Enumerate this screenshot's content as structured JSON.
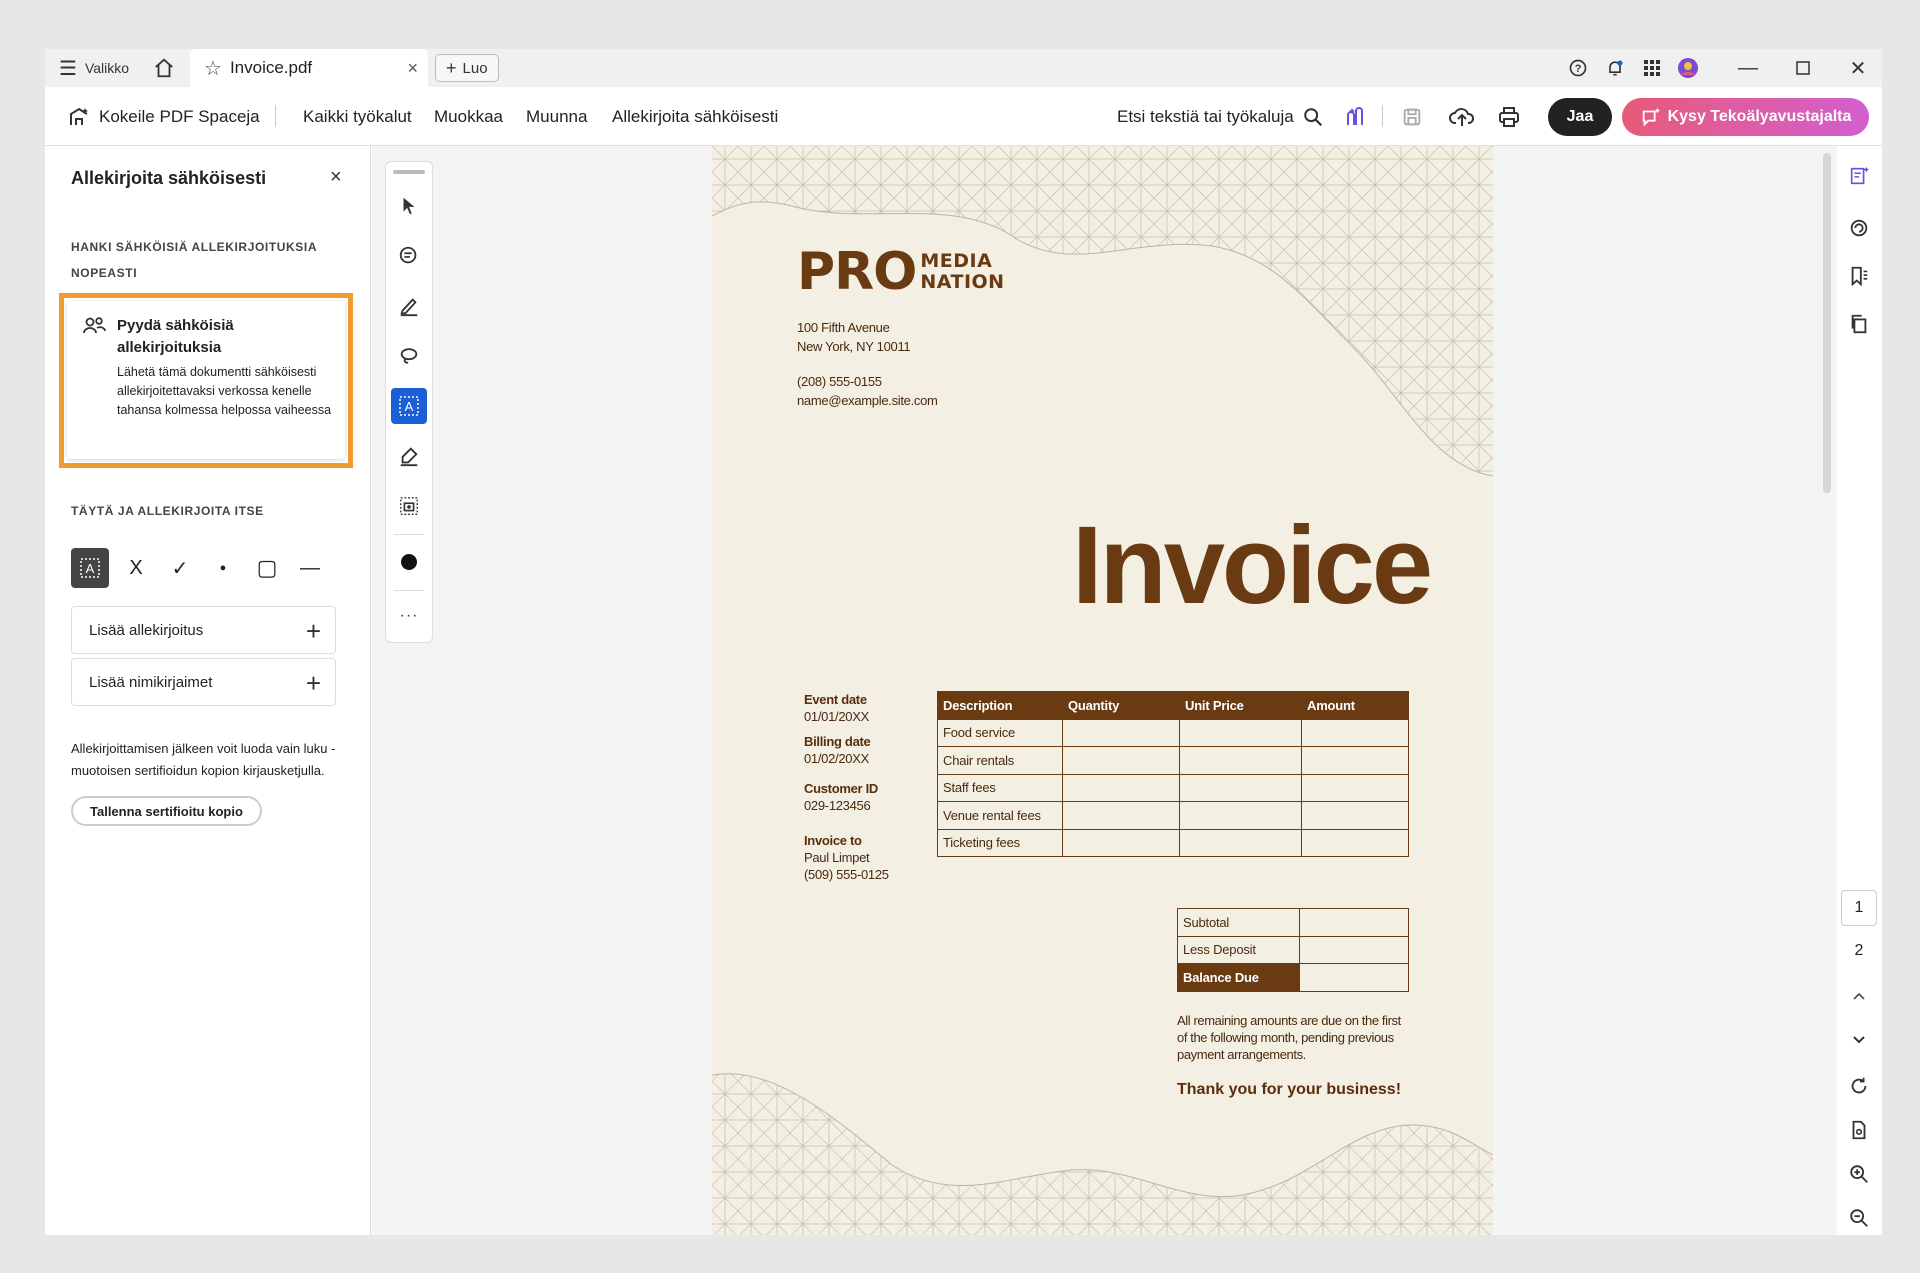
{
  "titlebar": {
    "menu_label": "Valikko",
    "tab_label": "Invoice.pdf",
    "new_label": "Luo"
  },
  "toolbar": {
    "spaces": "Kokeile PDF Spaceja",
    "all_tools": "Kaikki työkalut",
    "edit": "Muokkaa",
    "convert": "Muunna",
    "esign": "Allekirjoita sähköisesti",
    "search": "Etsi tekstiä tai työkaluja",
    "share": "Jaa",
    "ai": "Kysy Tekoälyavustajalta"
  },
  "left_panel": {
    "title": "Allekirjoita sähköisesti",
    "section1_line1": "HANKI SÄHKÖISIÄ ALLEKIRJOITUKSIA",
    "section1_line2": "NOPEASTI",
    "card_title": "Pyydä sähköisiä allekirjoituksia",
    "card_body": "Lähetä tämä dokumentti sähköisesti allekirjoitettavaksi verkossa kenelle tahansa kolmessa helpossa vaiheessa",
    "section2": "TÄYTÄ JA ALLEKIRJOITA ITSE",
    "tool_cross": "X",
    "tool_check": "✓",
    "tool_dot": "●",
    "tool_rect": "▢",
    "tool_line": "—",
    "add_signature": "Lisää allekirjoitus",
    "add_initials": "Lisää nimikirjaimet",
    "note": "Allekirjoittamisen jälkeen voit luoda vain luku -muotoisen sertifioidun kopion kirjausketjulla.",
    "save_certified": "Tallenna sertifioitu kopio"
  },
  "page_nav": {
    "page1": "1",
    "page2": "2"
  },
  "invoice": {
    "logo_pro": "PRO",
    "logo_media": "MEDIA",
    "logo_nation": "NATION",
    "address1": "100 Fifth Avenue",
    "address2": "New York, NY 10011",
    "phone": "(208) 555-0155",
    "email": "name@example.site.com",
    "title": "Invoice",
    "event_date_label": "Event date",
    "event_date": "01/01/20XX",
    "billing_date_label": "Billing date",
    "billing_date": "01/02/20XX",
    "customer_id_label": "Customer ID",
    "customer_id": "029-123456",
    "invoice_to_label": "Invoice to",
    "invoice_to_name": "Paul Limpet",
    "invoice_to_phone": "(509) 555-0125",
    "columns": [
      "Description",
      "Quantity",
      "Unit Price",
      "Amount"
    ],
    "items": [
      "Food service",
      "Chair rentals",
      "Staff fees",
      "Venue rental fees",
      "Ticketing fees"
    ],
    "subtotal": "Subtotal",
    "less_deposit": "Less Deposit",
    "balance_due": "Balance Due",
    "due_note": "All remaining amounts are due on the first of the following month, pending previous payment arrangements.",
    "thanks": "Thank you for your business!"
  },
  "colors": {
    "brand_brown": "#6a3a12",
    "page_bg": "#f3efe3",
    "highlight_orange": "#f39a2e",
    "active_tool_blue": "#1a5fd6"
  }
}
